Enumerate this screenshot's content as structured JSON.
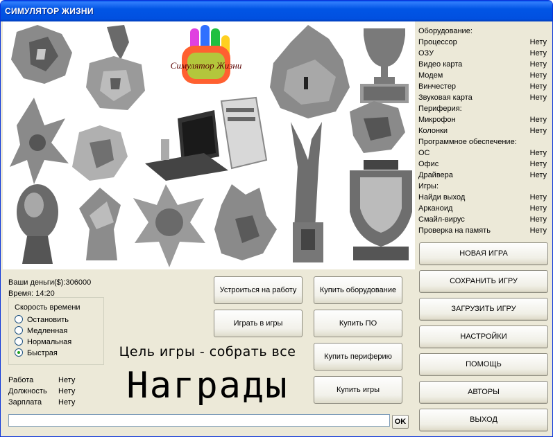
{
  "window": {
    "title": "СИМУЛЯТОР ЖИЗНИ"
  },
  "logo": {
    "text": "Симулятор Жизни"
  },
  "equipment": [
    {
      "name": "Оборудование:",
      "status": ""
    },
    {
      "name": "Процессор",
      "status": "Нету"
    },
    {
      "name": "ОЗУ",
      "status": "Нету"
    },
    {
      "name": "Видео карта",
      "status": "Нету"
    },
    {
      "name": "Модем",
      "status": "Нету"
    },
    {
      "name": "Винчестер",
      "status": "Нету"
    },
    {
      "name": "Звуковая карта",
      "status": "Нету"
    },
    {
      "name": "Периферия:",
      "status": ""
    },
    {
      "name": "Микрофон",
      "status": "Нету"
    },
    {
      "name": "Колонки",
      "status": "Нету"
    },
    {
      "name": "Программное обеспечение:",
      "status": ""
    },
    {
      "name": "ОС",
      "status": "Нету"
    },
    {
      "name": "Офис",
      "status": "Нету"
    },
    {
      "name": "Драйвера",
      "status": "Нету"
    },
    {
      "name": "Игры:",
      "status": ""
    },
    {
      "name": "Найди выход",
      "status": "Нету"
    },
    {
      "name": "Арканоид",
      "status": "Нету"
    },
    {
      "name": "Смайл-вирус",
      "status": "Нету"
    },
    {
      "name": "Проверка на память",
      "status": "Нету"
    }
  ],
  "menu": {
    "new_game": "НОВАЯ ИГРА",
    "save_game": "СОХРАНИТЬ ИГРУ",
    "load_game": "ЗАГРУЗИТЬ ИГРУ",
    "settings": "НАСТРОЙКИ",
    "help": "ПОМОЩЬ",
    "authors": "АВТОРЫ",
    "exit": "ВЫХОД"
  },
  "actions": {
    "get_job": "Устроиться на работу",
    "play_games": "Играть в игры",
    "buy_equipment": "Купить оборудование",
    "buy_software": "Купить ПО",
    "buy_peripherals": "Купить периферию",
    "buy_games": "Купить игры"
  },
  "status": {
    "money": "Ваши деньги($):306000",
    "time": "Время: 14:20"
  },
  "speed": {
    "legend": "Скорость времени",
    "options": [
      "Остановить",
      "Медленная",
      "Нормальная",
      "Быстрая"
    ],
    "selected": "Быстрая"
  },
  "stats": [
    {
      "label": "Работа",
      "value": "Нету"
    },
    {
      "label": "Должность",
      "value": "Нету"
    },
    {
      "label": "Зарплата",
      "value": "Нету"
    }
  ],
  "goal": {
    "line1": "Цель игры - собрать все",
    "line2": "Награды"
  },
  "command": {
    "value": "",
    "ok_label": "OK"
  }
}
